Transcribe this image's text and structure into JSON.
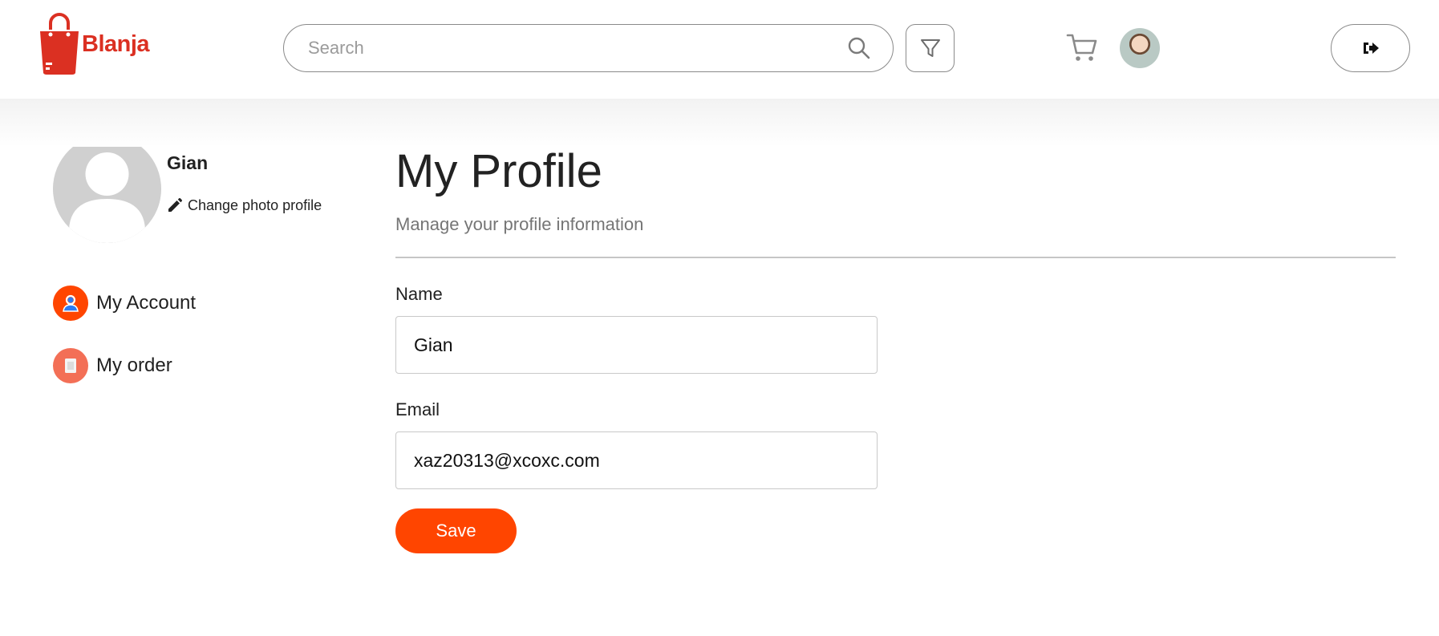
{
  "header": {
    "logo_text": "Blanja",
    "search": {
      "placeholder": "Search",
      "value": ""
    },
    "icons": {
      "search": "search-icon",
      "filter": "filter-icon",
      "cart": "cart-icon",
      "logout": "logout-icon"
    }
  },
  "sidebar": {
    "user_name": "Gian",
    "change_photo_label": "Change photo profile",
    "items": [
      {
        "label": "My Account",
        "icon": "user-icon",
        "color": "#ff4500"
      },
      {
        "label": "My order",
        "icon": "clipboard-icon",
        "color": "#f36f56"
      }
    ]
  },
  "main": {
    "title": "My Profile",
    "subtitle": "Manage your profile information",
    "form": {
      "name_label": "Name",
      "name_value": "Gian",
      "email_label": "Email",
      "email_value": "xaz20313@xcoxc.com",
      "save_label": "Save"
    }
  },
  "colors": {
    "accent": "#ff4500",
    "brand": "#db3022",
    "divider": "#c6c6c6"
  }
}
